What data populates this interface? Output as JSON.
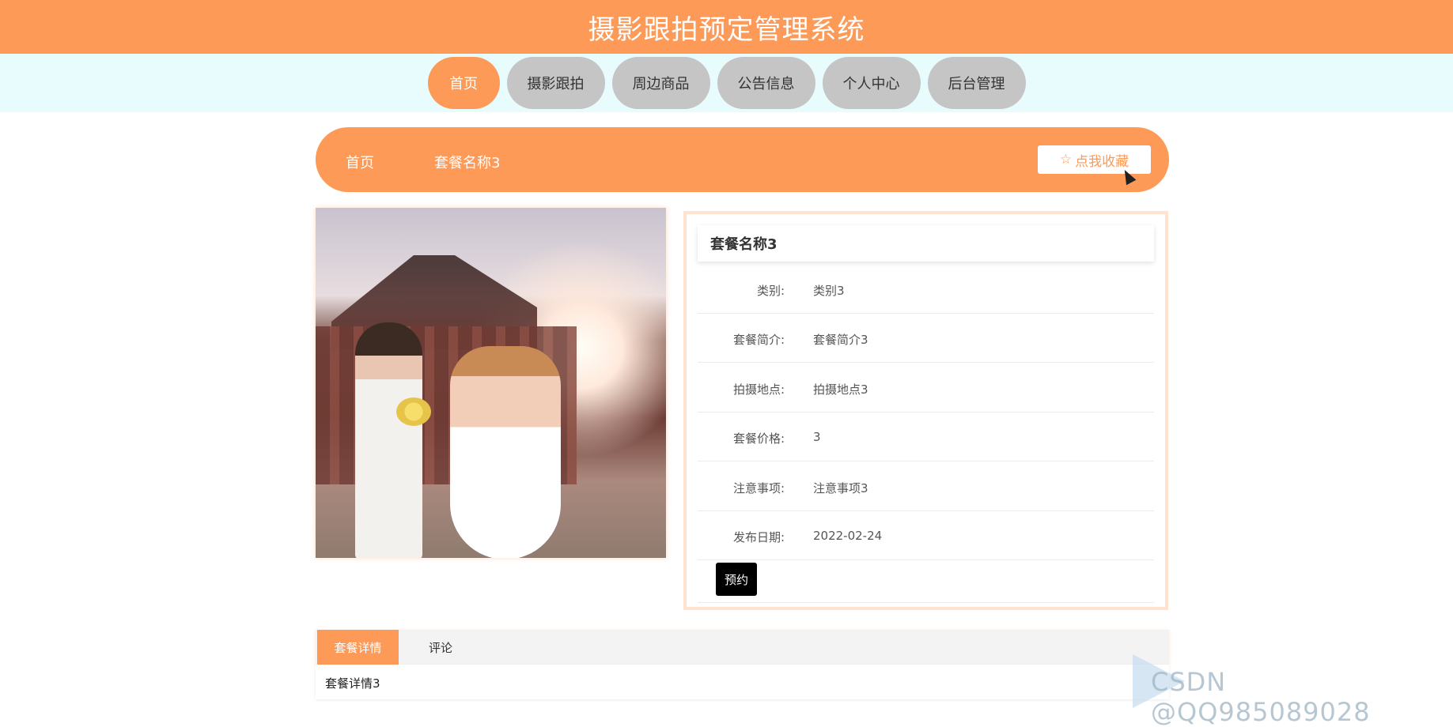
{
  "header": {
    "title": "摄影跟拍预定管理系统"
  },
  "nav": {
    "items": [
      {
        "label": "首页",
        "active": true
      },
      {
        "label": "摄影跟拍",
        "active": false
      },
      {
        "label": "周边商品",
        "active": false
      },
      {
        "label": "公告信息",
        "active": false
      },
      {
        "label": "个人中心",
        "active": false
      },
      {
        "label": "后台管理",
        "active": false
      }
    ]
  },
  "breadcrumb": {
    "home": "首页",
    "current": "套餐名称3"
  },
  "collect": {
    "label": "点我收藏",
    "icon": "star-outline-icon"
  },
  "product": {
    "image_alt": "wedding photo",
    "title": "套餐名称3",
    "fields": [
      {
        "label": "类别:",
        "value": "类别3"
      },
      {
        "label": "套餐简介:",
        "value": "套餐简介3"
      },
      {
        "label": "拍摄地点:",
        "value": "拍摄地点3"
      },
      {
        "label": "套餐价格:",
        "value": "3"
      },
      {
        "label": "注意事项:",
        "value": "注意事项3"
      },
      {
        "label": "发布日期:",
        "value": "2022-02-24"
      }
    ],
    "book_label": "预约"
  },
  "tabs": [
    {
      "label": "套餐详情",
      "active": true
    },
    {
      "label": "评论",
      "active": false
    }
  ],
  "tab_content": "套餐详情3",
  "watermark": "CSDN @QQ985089028",
  "colors": {
    "primary": "#fd9a58",
    "nav_inactive": "#c5c5c5",
    "nav_bg": "#e8fbfd"
  }
}
